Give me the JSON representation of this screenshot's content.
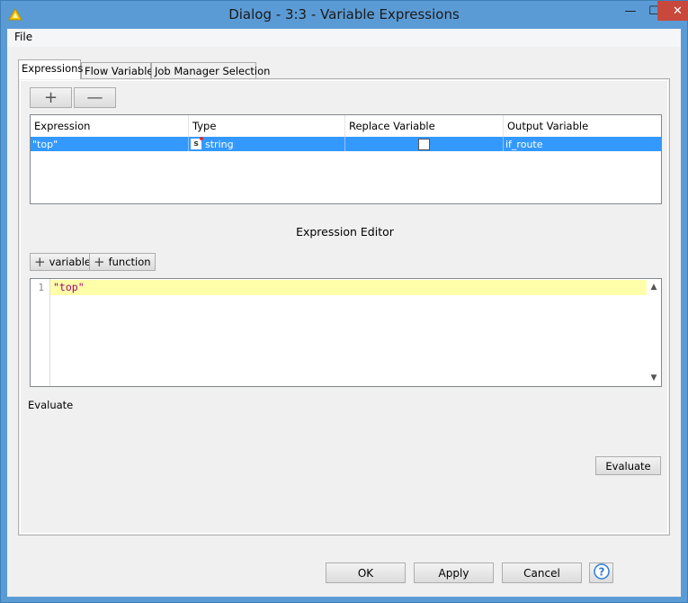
{
  "window": {
    "title": "Dialog - 3:3 - Variable Expressions",
    "minimize_glyph": "—",
    "maximize_glyph": "☐",
    "close_glyph": "✕"
  },
  "menubar": {
    "file": "File"
  },
  "tabs": [
    {
      "label": "Expressions",
      "active": true
    },
    {
      "label": "Flow Variables",
      "active": false
    },
    {
      "label": "Job Manager Selection",
      "active": false
    }
  ],
  "toolbar": {
    "add_glyph": "+",
    "remove_glyph": "—"
  },
  "table": {
    "headers": [
      "Expression",
      "Type",
      "Replace Variable",
      "Output Variable"
    ],
    "rows": [
      {
        "expression": "\"top\"",
        "type_icon": "s",
        "type": "string",
        "replace_variable": false,
        "output_variable": "if_route"
      }
    ]
  },
  "editor": {
    "heading": "Expression Editor",
    "variable_button": "variable",
    "function_button": "function",
    "lines": [
      {
        "number": "1",
        "text": "\"top\""
      }
    ]
  },
  "evaluate": {
    "label": "Evaluate",
    "button": "Evaluate"
  },
  "footer": {
    "ok": "OK",
    "apply": "Apply",
    "cancel": "Cancel"
  },
  "icons": {
    "app": "knime-triangle-icon",
    "help": "help-circle-icon",
    "scroll_up": "▲",
    "scroll_down": "▼"
  },
  "colors": {
    "titlebar": "#5b9bd5",
    "selection": "#3399ff",
    "close": "#c9483c",
    "current_line": "#ffffaa",
    "string_literal": "#a0006e"
  }
}
